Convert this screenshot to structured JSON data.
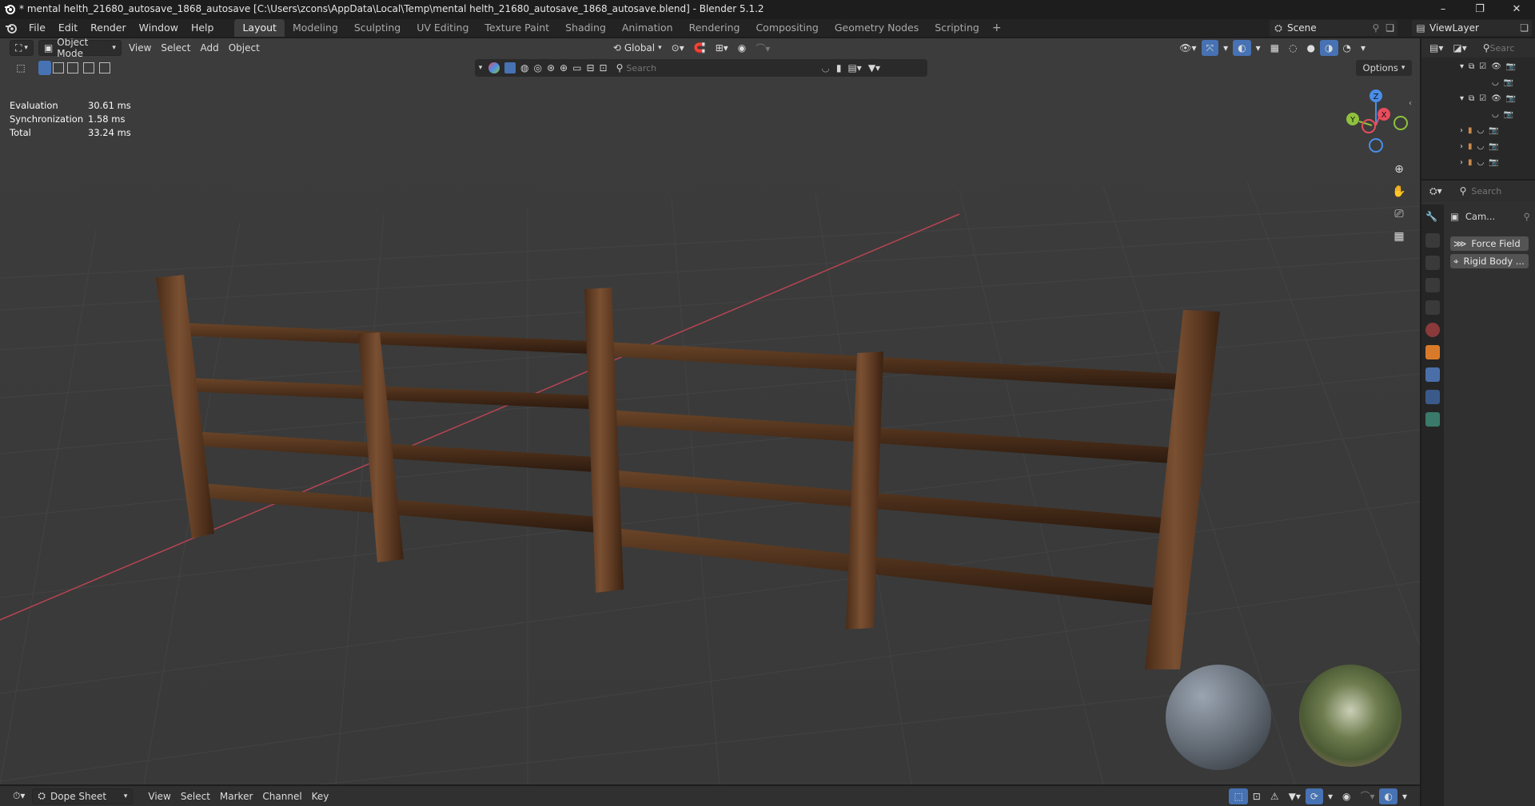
{
  "window": {
    "title": "* mental helth_21680_autosave_1868_autosave [C:\\Users\\zcons\\AppData\\Local\\Temp\\mental helth_21680_autosave_1868_autosave.blend] - Blender 5.1.2",
    "minimize": "–",
    "maximize": "❐",
    "close": "✕"
  },
  "menus": [
    "File",
    "Edit",
    "Render",
    "Window",
    "Help"
  ],
  "workspaces": [
    "Layout",
    "Modeling",
    "Sculpting",
    "UV Editing",
    "Texture Paint",
    "Shading",
    "Animation",
    "Rendering",
    "Compositing",
    "Geometry Nodes",
    "Scripting"
  ],
  "active_workspace": "Layout",
  "scene_name": "Scene",
  "view_layer_name": "ViewLayer",
  "viewport": {
    "mode": "Object Mode",
    "menus": [
      "View",
      "Select",
      "Add",
      "Object"
    ],
    "transform_orientation": "Global",
    "search_placeholder": "Search",
    "options_label": "Options"
  },
  "stats": [
    {
      "label": "Evaluation",
      "value": "30.61 ms"
    },
    {
      "label": "Synchronization",
      "value": "1.58 ms"
    },
    {
      "label": "Total",
      "value": "33.24 ms"
    }
  ],
  "gizmo": {
    "x": "X",
    "y": "Y",
    "z": "Z"
  },
  "outliner": {
    "search_placeholder": "Search"
  },
  "properties": {
    "search_placeholder": "Search",
    "object_name": "Cam...",
    "buttons": [
      "Force Field",
      "Rigid Body ..."
    ]
  },
  "dopesheet": {
    "editor": "Dope Sheet",
    "menus": [
      "View",
      "Select",
      "Marker",
      "Channel",
      "Key"
    ]
  },
  "colors": {
    "accent_blue": "#4772b3",
    "x_axis": "#e84d5c",
    "y_axis": "#8fc23d",
    "z_axis": "#4a8ee8"
  }
}
